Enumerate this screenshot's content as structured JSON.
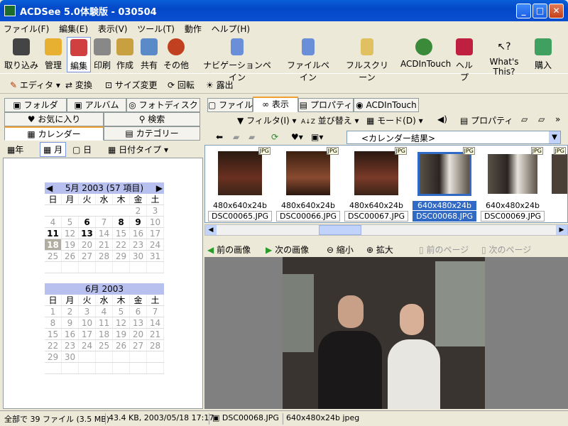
{
  "window": {
    "title": "ACDSee 5.0体験版 - 030504",
    "min": "_",
    "max": "□",
    "close": "✕"
  },
  "menu": [
    "ファイル(F)",
    "編集(E)",
    "表示(V)",
    "ツール(T)",
    "動作",
    "ヘルプ(H)"
  ],
  "toolbar1": {
    "left": [
      "取り込み",
      "管理",
      "編集",
      "印刷",
      "作成",
      "共有",
      "その他"
    ],
    "nav_pane": "ナビゲーションペイン",
    "file_pane": "ファイルペイン",
    "fullscreen": "フルスクリーン",
    "acdintouch": "ACDInTouch",
    "help": "ヘルプ",
    "whats_this": "What's This?",
    "buy": "購入"
  },
  "toolbar2": {
    "editor": "エディタ",
    "convert": "変換",
    "resize": "サイズ変更",
    "rotate": "回転",
    "exposure": "露出"
  },
  "left_tabs": {
    "folder": "フォルダ",
    "album": "アルバム",
    "photodisc": "フォトディスク",
    "favorites": "お気に入り",
    "search": "検索",
    "calendar": "カレンダー",
    "category": "カテゴリー"
  },
  "cal_view": {
    "year": "年",
    "month": "月",
    "day": "日",
    "date_type": "日付タイプ"
  },
  "calendar_may": {
    "header": "5月 2003 (57 項目)",
    "weekdays": [
      "日",
      "月",
      "火",
      "水",
      "木",
      "金",
      "土"
    ],
    "rows": [
      [
        "27",
        "28",
        "29",
        "30",
        "1",
        "2",
        "3"
      ],
      [
        "4",
        "5",
        "6",
        "7",
        "8",
        "9",
        "10"
      ],
      [
        "11",
        "12",
        "13",
        "14",
        "15",
        "16",
        "17"
      ],
      [
        "18",
        "19",
        "20",
        "21",
        "22",
        "23",
        "24"
      ],
      [
        "25",
        "26",
        "27",
        "28",
        "29",
        "30",
        "31"
      ]
    ]
  },
  "calendar_june": {
    "header": "6月 2003",
    "weekdays": [
      "日",
      "月",
      "火",
      "水",
      "木",
      "金",
      "土"
    ],
    "rows": [
      [
        "1",
        "2",
        "3",
        "4",
        "5",
        "6",
        "7"
      ],
      [
        "8",
        "9",
        "10",
        "11",
        "12",
        "13",
        "14"
      ],
      [
        "15",
        "16",
        "17",
        "18",
        "19",
        "20",
        "21"
      ],
      [
        "22",
        "23",
        "24",
        "25",
        "26",
        "27",
        "28"
      ],
      [
        "29",
        "30",
        "",
        "",
        "",
        "",
        ""
      ]
    ]
  },
  "right_tabs": {
    "file": "ファイル",
    "view": "表示",
    "properties": "プロパティ",
    "acdintouch": "ACDInTouch"
  },
  "right_toolbar": {
    "filter": "フィルタ(I)",
    "sort": "並び替え",
    "mode": "モード(D)",
    "properties": "プロパティ"
  },
  "location": "<カレンダー結果>",
  "thumbnails": [
    {
      "dim": "480x640x24b",
      "file": "DSC00065.JPG",
      "badge": "JPG"
    },
    {
      "dim": "480x640x24b",
      "file": "DSC00066.JPG",
      "badge": "JPG"
    },
    {
      "dim": "480x640x24b",
      "file": "DSC00067.JPG",
      "badge": "JPG"
    },
    {
      "dim": "640x480x24b",
      "file": "DSC00068.JPG",
      "badge": "JPG"
    },
    {
      "dim": "640x480x24b",
      "file": "DSC00069.JPG",
      "badge": "JPG"
    },
    {
      "dim": "64",
      "file": "",
      "badge": "JPG"
    }
  ],
  "navbar": {
    "prev_image": "前の画像",
    "next_image": "次の画像",
    "zoom_out": "縮小",
    "zoom_in": "拡大",
    "prev_page": "前のページ",
    "next_page": "次のページ"
  },
  "status": {
    "total": "全部で 39 ファイル (3.5 MB)",
    "info": "43.4 KB, 2003/05/18 17:17",
    "file": "DSC00068.JPG",
    "meta": "640x480x24b jpeg"
  }
}
